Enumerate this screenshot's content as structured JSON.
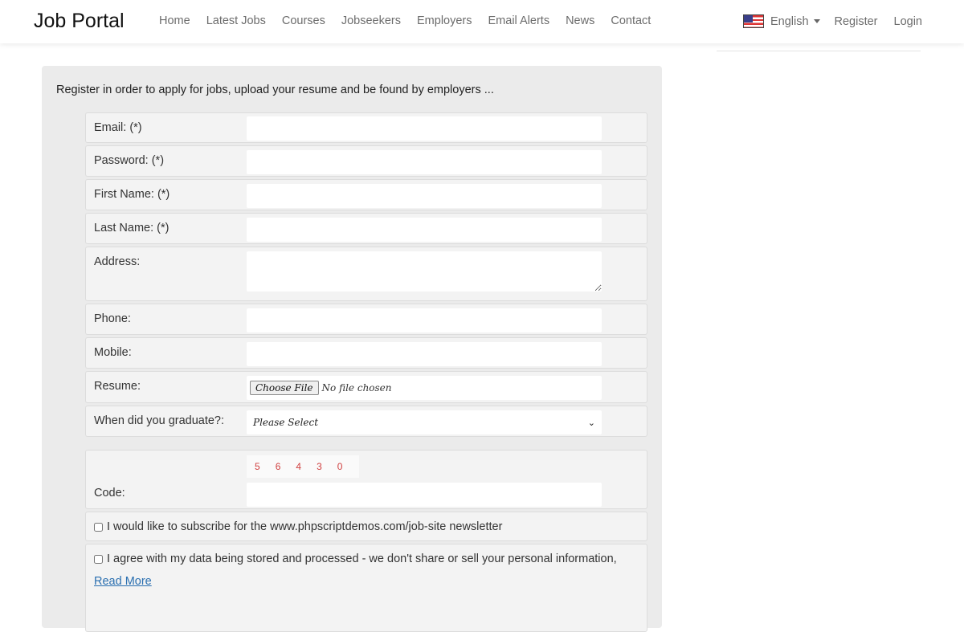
{
  "nav": {
    "brand": "Job Portal",
    "links": [
      "Home",
      "Latest Jobs",
      "Courses",
      "Jobseekers",
      "Employers",
      "Email Alerts",
      "News",
      "Contact"
    ],
    "language": "English",
    "register": "Register",
    "login": "Login",
    "flag_icon": "us-flag-icon"
  },
  "form": {
    "intro": "Register in order to apply for jobs, upload your resume and be found by employers ...",
    "fields": [
      {
        "label": "Email: (*)",
        "value": ""
      },
      {
        "label": "Password: (*)",
        "value": ""
      },
      {
        "label": "First Name: (*)",
        "value": ""
      },
      {
        "label": "Last Name: (*)",
        "value": ""
      },
      {
        "label": "Address:",
        "value": ""
      },
      {
        "label": "Phone:",
        "value": ""
      },
      {
        "label": "Mobile:",
        "value": ""
      },
      {
        "label": "Resume:",
        "button": "Choose File",
        "status": "No file chosen"
      },
      {
        "label": "When did you graduate?:",
        "selected": "Please Select"
      },
      {
        "label": "Code:",
        "captcha": [
          "5",
          "6",
          "4",
          "3",
          "0"
        ],
        "value": ""
      }
    ],
    "newsletter": "I would like to subscribe for the www.phpscriptdemos.com/job-site newsletter",
    "agree": "I agree with my data being stored and processed - we don't share or sell your personal information,",
    "read_more": "Read More"
  }
}
